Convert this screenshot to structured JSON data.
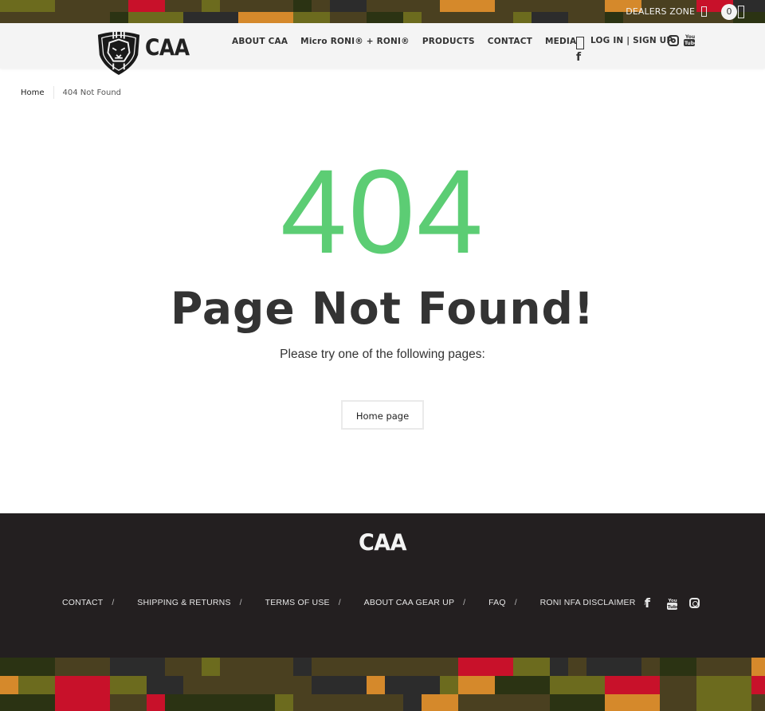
{
  "topbar": {
    "dealers_zone": "DEALERS ZONE",
    "cart_count": "0",
    "icons": [
      "user-icon",
      "cart-icon"
    ]
  },
  "header": {
    "logo_text": "CAA",
    "logo_icon": "lion-shield-icon",
    "nav": [
      {
        "label": "ABOUT CAA"
      },
      {
        "label": "Micro RONI® + RONI®"
      },
      {
        "label": "PRODUCTS"
      },
      {
        "label": "CONTACT"
      },
      {
        "label": "MEDIA"
      }
    ],
    "account_label": "LOG IN | SIGN UP",
    "social_icons": [
      "facebook-icon",
      "instagram-icon",
      "youtube-icon"
    ]
  },
  "breadcrumb": {
    "home": "Home",
    "current": "404 Not Found"
  },
  "main": {
    "code": "404",
    "title": "Page Not Found!",
    "subtitle": "Please try one of the following pages:",
    "home_button": "Home page",
    "accent_color": "#5ccd74"
  },
  "footer": {
    "logo_text": "CAA",
    "links": [
      {
        "label": "CONTACT"
      },
      {
        "label": "SHIPPING & RETURNS"
      },
      {
        "label": "TERMS OF USE"
      },
      {
        "label": "ABOUT CAA GEAR UP"
      },
      {
        "label": "FAQ"
      },
      {
        "label": "RONI NFA DISCLAIMER"
      }
    ],
    "separator": "/",
    "social_icons": [
      "facebook-icon",
      "youtube-icon",
      "instagram-icon"
    ],
    "background_color": "#231f20"
  },
  "camo_colors": [
    "#4a4020",
    "#c8112a",
    "#d5892b",
    "#2b3313",
    "#2c2c2c",
    "#6c6b1e"
  ]
}
